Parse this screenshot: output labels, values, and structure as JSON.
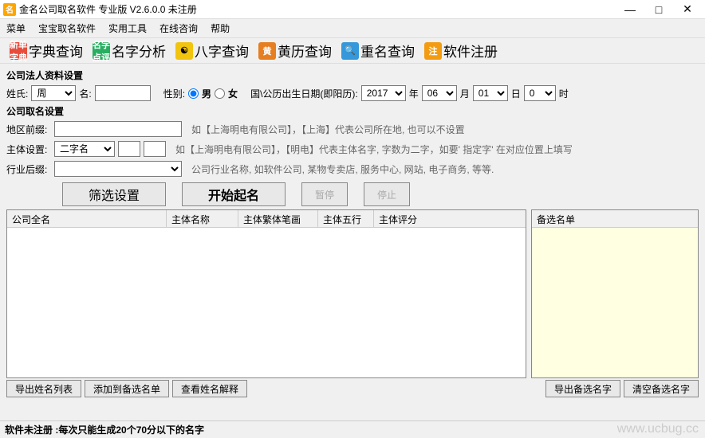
{
  "window": {
    "title": "金名公司取名软件 专业版 V2.6.0.0 未注册",
    "minimize": "—",
    "maximize": "□",
    "close": "✕"
  },
  "menu": {
    "m1": "菜单",
    "m2": "宝宝取名软件",
    "m3": "实用工具",
    "m4": "在线咨询",
    "m5": "帮助"
  },
  "toolbar": {
    "t1": "字典查询",
    "t2": "名字分析",
    "t3": "八字查询",
    "t4": "黄历查询",
    "t5": "重名查询",
    "t6": "软件注册"
  },
  "group1": {
    "title": "公司法人资料设置",
    "surname_label": "姓氏:",
    "surname_value": "周",
    "name_label": "名:",
    "name_value": "",
    "gender_label": "性别:",
    "male": "男",
    "female": "女",
    "birth_label": "国\\公历出生日期(即阳历):",
    "year": "2017",
    "year_unit": "年",
    "month": "06",
    "month_unit": "月",
    "day": "01",
    "day_unit": "日",
    "hour": "0",
    "hour_unit": "时"
  },
  "group2": {
    "title": "公司取名设置",
    "prefix_label": "地区前缀:",
    "prefix_value": "",
    "prefix_hint": "如【上海明电有限公司】，【上海】代表公司所在地, 也可以不设置",
    "body_label": "主体设置:",
    "body_value": "二字名",
    "body_extra": "",
    "body_hint": "如【上海明电有限公司】，【明电】代表主体名字, 字数为二字，如要' 指定字' 在对应位置上填写",
    "suffix_label": "行业后缀:",
    "suffix_value": "",
    "suffix_hint": "公司行业名称, 如软件公司, 某物专卖店, 服务中心, 网站, 电子商务, 等等."
  },
  "buttons": {
    "filter": "筛选设置",
    "start": "开始起名",
    "pause": "暂停",
    "stop": "停止"
  },
  "table": {
    "col1": "公司全名",
    "col2": "主体名称",
    "col3": "主体繁体笔画",
    "col4": "主体五行",
    "col5": "主体评分",
    "right_header": "备选名单"
  },
  "bottom": {
    "b1": "导出姓名列表",
    "b2": "添加到备选名单",
    "b3": "查看姓名解释",
    "b4": "导出备选名字",
    "b5": "清空备选名字"
  },
  "status": {
    "prefix": "软件未注册 :",
    "text": "每次只能生成20个70分以下的名字"
  },
  "watermark": "www.ucbug.cc"
}
